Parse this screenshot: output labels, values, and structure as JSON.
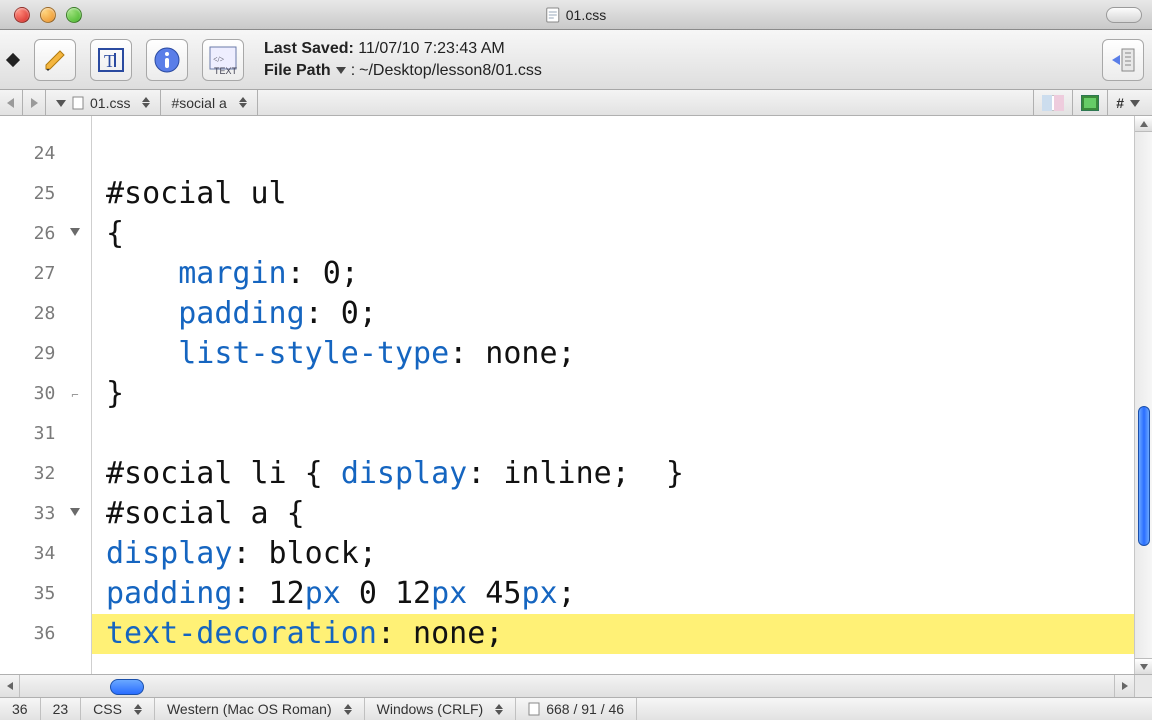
{
  "window": {
    "title": "01.css"
  },
  "toolbar": {
    "last_saved_label": "Last Saved:",
    "last_saved_value": "11/07/10 7:23:43 AM",
    "file_path_label": "File Path",
    "file_path_value": "~/Desktop/lesson8/01.css"
  },
  "navbar": {
    "file_dropdown": "01.css",
    "symbol_dropdown": "#social a",
    "hash_label": "#"
  },
  "gutter": {
    "start": 24,
    "end": 36
  },
  "code": {
    "l25_sel": "#social ul",
    "l26": "{",
    "l27_prop": "margin",
    "l27_rest": ": 0;",
    "l28_prop": "padding",
    "l28_rest": ": 0;",
    "l29_prop": "list-style-type",
    "l29_rest": ": none;",
    "l30": "}",
    "l32_sel": "#social li { ",
    "l32_prop": "display",
    "l32_rest": ": inline;  }",
    "l33_sel": "#social a {",
    "l34_prop": "display",
    "l34_rest": ": block;",
    "l35_prop": "padding",
    "l35_rest_a": ": 12",
    "l35_unit1": "px",
    "l35_rest_b": " 0 12",
    "l35_unit2": "px",
    "l35_rest_c": " 45",
    "l35_unit3": "px",
    "l35_rest_d": ";",
    "l36_prop": "text-decoration",
    "l36_rest": ": none;"
  },
  "status": {
    "line": "36",
    "col": "23",
    "language": "CSS",
    "encoding": "Western (Mac OS Roman)",
    "line_endings": "Windows (CRLF)",
    "counts": "668 / 91 / 46"
  }
}
